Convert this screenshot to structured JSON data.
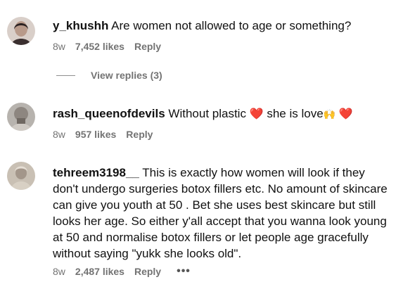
{
  "comments": [
    {
      "username": "y_khushh",
      "text": "Are women not allowed to age or something?",
      "time": "8w",
      "likes": "7,452 likes",
      "reply": "Reply",
      "view_replies": "View replies (3)"
    },
    {
      "username": "rash_queenofdevils",
      "text_part1": "Without plastic",
      "heart1": "❤️",
      "text_part2": "she is love",
      "emoji2": "🙌",
      "heart2": "❤️",
      "time": "8w",
      "likes": "957 likes",
      "reply": "Reply"
    },
    {
      "username": "tehreem3198__",
      "text": "This is exactly how women will look if they don't undergo surgeries botox fillers etc. No amount of skincare can give you youth at 50 . Bet she uses best skincare but still looks her age. So either y'all accept that you wanna look young at 50 and normalise botox fillers or let people age gracefully without saying \"yukk she looks old\".",
      "time": "8w",
      "likes": "2,487 likes",
      "reply": "Reply",
      "more": "•••"
    }
  ],
  "colors": {
    "text": "#111111",
    "meta": "#737373",
    "heart": "#e0245e"
  },
  "icons": [
    "avatar-photo",
    "heart-icon",
    "raising-hands-icon",
    "more-options-icon"
  ]
}
